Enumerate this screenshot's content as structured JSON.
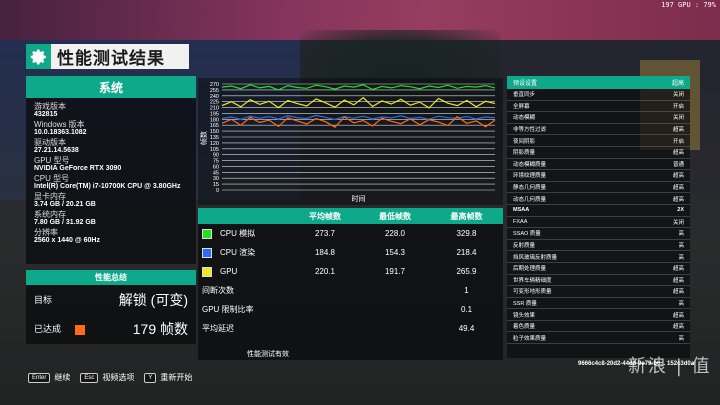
{
  "overlay": {
    "fps_counter": "197 GPU : 79%"
  },
  "header": {
    "title": "性能测试结果"
  },
  "system": {
    "title": "系统",
    "items": [
      {
        "label": "游戏版本",
        "value": "432815"
      },
      {
        "label": "Windows 版本",
        "value": "10.0.18363.1082"
      },
      {
        "label": "驱动版本",
        "value": "27.21.14.5638"
      },
      {
        "label": "GPU 型号",
        "value": "NVIDIA GeForce RTX 3090"
      },
      {
        "label": "CPU 型号",
        "value": "Intel(R) Core(TM) i7-10700K CPU @ 3.80GHz"
      },
      {
        "label": "显卡内存",
        "value": "3.74 GB / 20.21 GB"
      },
      {
        "label": "系统内存",
        "value": "7.80 GB / 31.92 GB"
      },
      {
        "label": "分辨率",
        "value": "2560 x 1440 @ 60Hz"
      }
    ]
  },
  "summary": {
    "title": "性能总结",
    "goal_label": "目标",
    "goal_value": "解锁 (可变)",
    "reached_label": "已达成",
    "reached_value": "179 帧数",
    "reached_color": "#ff6a16"
  },
  "chart_data": {
    "type": "line",
    "ylabel": "帧数",
    "xlabel": "时间",
    "yticks": [
      270,
      255,
      240,
      225,
      210,
      195,
      180,
      165,
      150,
      135,
      120,
      105,
      90,
      75,
      60,
      45,
      30,
      15,
      0
    ],
    "ylim": [
      0,
      270
    ],
    "series": [
      {
        "color": "#22e022",
        "values": [
          262,
          265,
          258,
          268,
          260,
          264,
          255,
          266,
          261,
          259,
          267,
          263,
          257,
          265,
          262,
          268,
          256,
          264,
          260,
          266,
          263,
          258,
          265,
          261,
          267,
          259,
          264,
          262,
          266,
          260
        ]
      },
      {
        "color": "#f3e81f",
        "values": [
          215,
          225,
          212,
          230,
          218,
          226,
          210,
          228,
          220,
          214,
          232,
          222,
          211,
          229,
          217,
          235,
          213,
          227,
          219,
          231,
          216,
          224,
          209,
          233,
          221,
          215,
          228,
          212,
          226,
          220
        ]
      },
      {
        "color": "#2a6df5",
        "values": [
          182,
          186,
          180,
          188,
          183,
          187,
          181,
          189,
          184,
          182,
          190,
          185,
          180,
          187,
          183,
          188,
          181,
          186,
          184,
          189,
          182,
          185,
          180,
          188,
          184,
          183,
          187,
          181,
          186,
          184
        ]
      },
      {
        "color": "#ff6a16",
        "values": [
          170,
          180,
          165,
          185,
          172,
          178,
          162,
          184,
          176,
          168,
          182,
          174,
          160,
          186,
          171,
          177,
          163,
          183,
          175,
          169,
          181,
          166,
          179,
          173,
          164,
          187,
          170,
          176,
          161,
          178
        ]
      }
    ]
  },
  "results": {
    "headers": [
      "平均帧数",
      "最低帧数",
      "最高帧数"
    ],
    "rows": [
      {
        "label": "CPU 模拟",
        "color": "#22e022",
        "avg": "273.7",
        "min": "228.0",
        "max": "329.8"
      },
      {
        "label": "CPU 渲染",
        "color": "#2a6df5",
        "avg": "184.8",
        "min": "154.3",
        "max": "218.4"
      },
      {
        "label": "GPU",
        "color": "#f3e81f",
        "avg": "220.1",
        "min": "191.7",
        "max": "265.9"
      }
    ],
    "stutter_label": "间断次数",
    "stutter_value": "1",
    "gpu_limit_label": "GPU 限制比率",
    "gpu_limit_value": "0.1",
    "latency_label": "平均延迟",
    "latency_value": "49.4",
    "valid_text": "性能测试有效"
  },
  "preset": {
    "title": "预设设置",
    "title_value": "超高",
    "rows": [
      {
        "k": "垂直同步",
        "v": "关闭"
      },
      {
        "k": "全屏幕",
        "v": "开启"
      },
      {
        "k": "动态模糊",
        "v": "关闭"
      },
      {
        "k": "非等方性过滤",
        "v": "超高"
      },
      {
        "k": "夜间阴影",
        "v": "开启"
      },
      {
        "k": "阴影质量",
        "v": "超高"
      },
      {
        "k": "动态模糊质量",
        "v": "普通"
      },
      {
        "k": "环境纹理质量",
        "v": "超高"
      },
      {
        "k": "静态几何质量",
        "v": "超高"
      },
      {
        "k": "动态几何质量",
        "v": "超高"
      },
      {
        "k": "MSAA",
        "v": "2X",
        "bold": true
      },
      {
        "k": "FXAA",
        "v": "关闭"
      },
      {
        "k": "SSAO 质量",
        "v": "高"
      },
      {
        "k": "反射质量",
        "v": "高"
      },
      {
        "k": "挡风玻璃反射质量",
        "v": "高"
      },
      {
        "k": "后期处理质量",
        "v": "超高"
      },
      {
        "k": "世界车辆精细度",
        "v": "超高"
      },
      {
        "k": "可变形地形质量",
        "v": "超高"
      },
      {
        "k": "SSR 质量",
        "v": "高"
      },
      {
        "k": "镜头效果",
        "v": "超高"
      },
      {
        "k": "着色质量",
        "v": "超高"
      },
      {
        "k": "粒子效果质量",
        "v": "高"
      }
    ]
  },
  "hash": "9666c4c8-20d2-44d8-9e79-b6... 152c3d0a ",
  "hints": [
    {
      "key": "Enter",
      "label": "继续"
    },
    {
      "key": "Esc",
      "label": "视频选项"
    },
    {
      "key": "Y",
      "label": "重新开始"
    }
  ],
  "watermark": "新浪 | 值"
}
